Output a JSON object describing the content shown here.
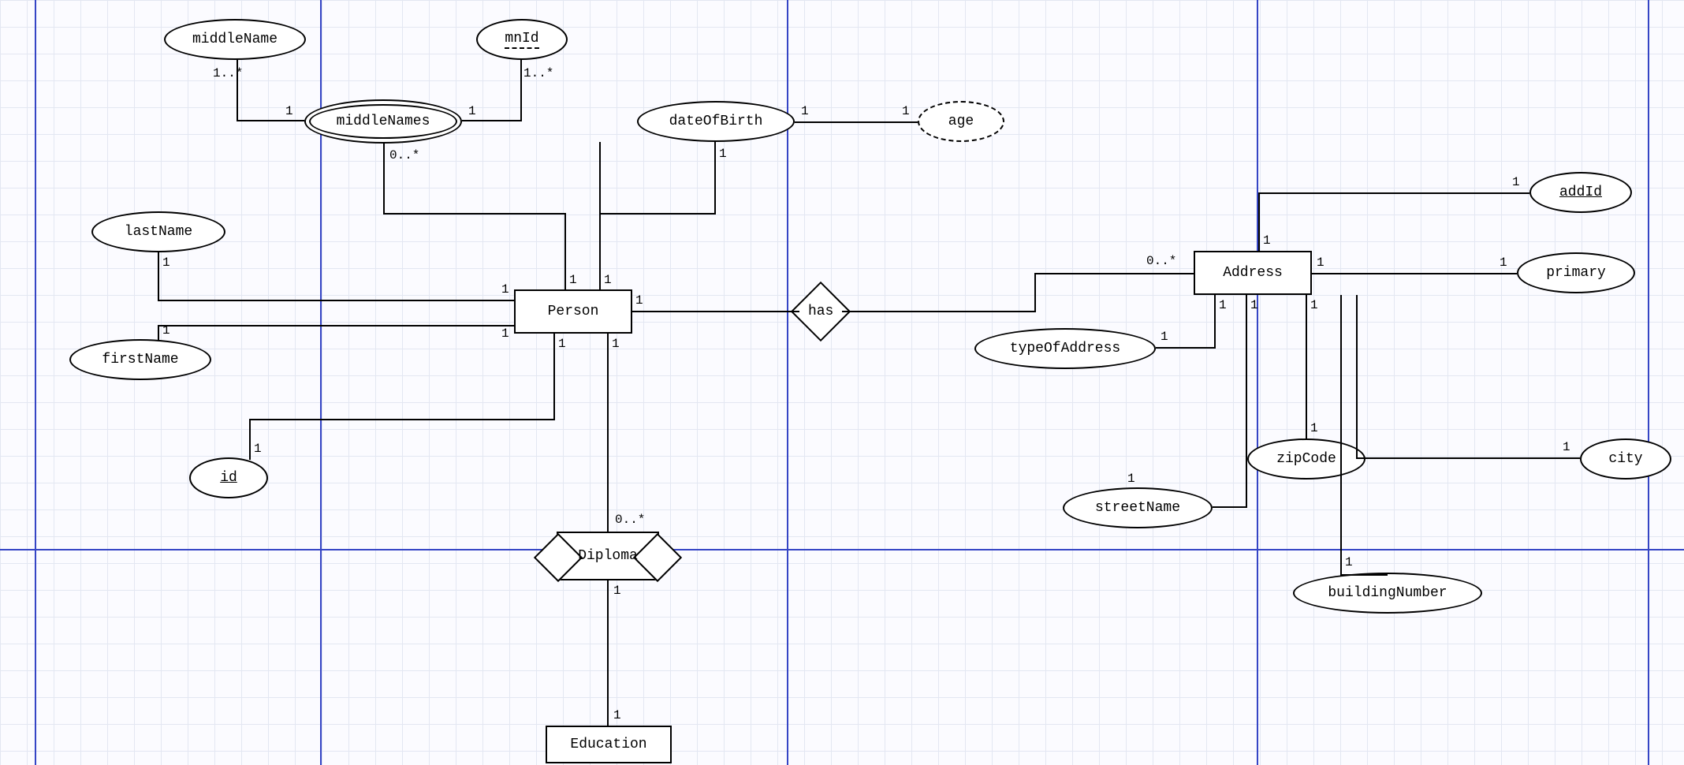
{
  "diagram_type": "Entity-Relationship Diagram",
  "entities": {
    "person": "Person",
    "address": "Address",
    "education": "Education"
  },
  "relationships": {
    "has": "has",
    "diploma": "Diploma"
  },
  "attributes": {
    "middleName": "middleName",
    "mnId": "mnId",
    "middleNames": "middleNames",
    "dateOfBirth": "dateOfBirth",
    "age": "age",
    "lastName": "lastName",
    "firstName": "firstName",
    "id": "id",
    "addId": "addId",
    "primary": "primary",
    "typeOfAddress": "typeOfAddress",
    "zipCode": "zipCode",
    "city": "city",
    "streetName": "streetName",
    "buildingNumber": "buildingNumber"
  },
  "cardinalities": {
    "one": "1",
    "zero_many": "0..*",
    "one_many": "1..*"
  },
  "guides": {
    "v1": 44,
    "v2": 406,
    "v3": 998,
    "v4": 1594,
    "v5": 2090,
    "h1": 696
  }
}
